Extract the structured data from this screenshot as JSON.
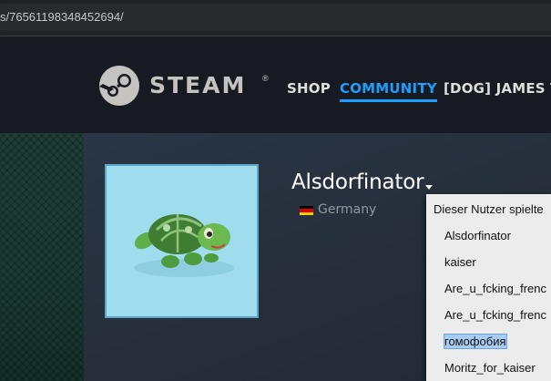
{
  "browser": {
    "url": "s/76561198348452694/"
  },
  "header": {
    "brand": "STEAM",
    "trademark": "®",
    "nav": {
      "shop": "SHOP",
      "community": "COMMUNITY",
      "user": "[DOG] JAMES T."
    }
  },
  "profile": {
    "persona_name": "Alsdorfinator",
    "country": "Germany",
    "flag_colors": [
      "#000000",
      "#dd0000",
      "#ffce00"
    ]
  },
  "name_history": {
    "title": "Dieser Nutzer spielte",
    "items": [
      "Alsdorfinator",
      "kaiser",
      "Are_u_fcking_frenc",
      "Are_u_fcking_frenc",
      "гомофобия",
      "Moritz_for_kaiser"
    ],
    "selected_index": 4
  },
  "colors": {
    "accent": "#1a9fff",
    "header_bg": "#171a21",
    "avatar_bg": "#9fdcee"
  }
}
